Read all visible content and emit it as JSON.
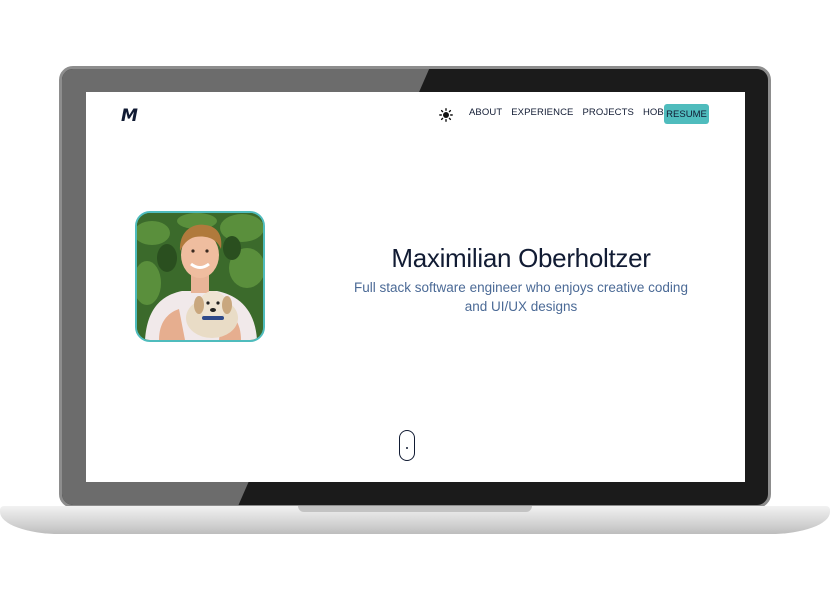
{
  "header": {
    "logo_text": "M",
    "theme_icon": "sun-icon",
    "nav": [
      {
        "label": "ABOUT"
      },
      {
        "label": "EXPERIENCE"
      },
      {
        "label": "PROJECTS"
      },
      {
        "label": "HOBBIES"
      }
    ],
    "resume_label": "RESUME"
  },
  "hero": {
    "name": "Maximilian Oberholtzer",
    "tagline": "Full stack software engineer who enjoys creative coding and UI/UX designs"
  },
  "colors": {
    "accent": "#4fbcbd",
    "text_dark": "#111b33",
    "tagline": "#4b6a96"
  }
}
